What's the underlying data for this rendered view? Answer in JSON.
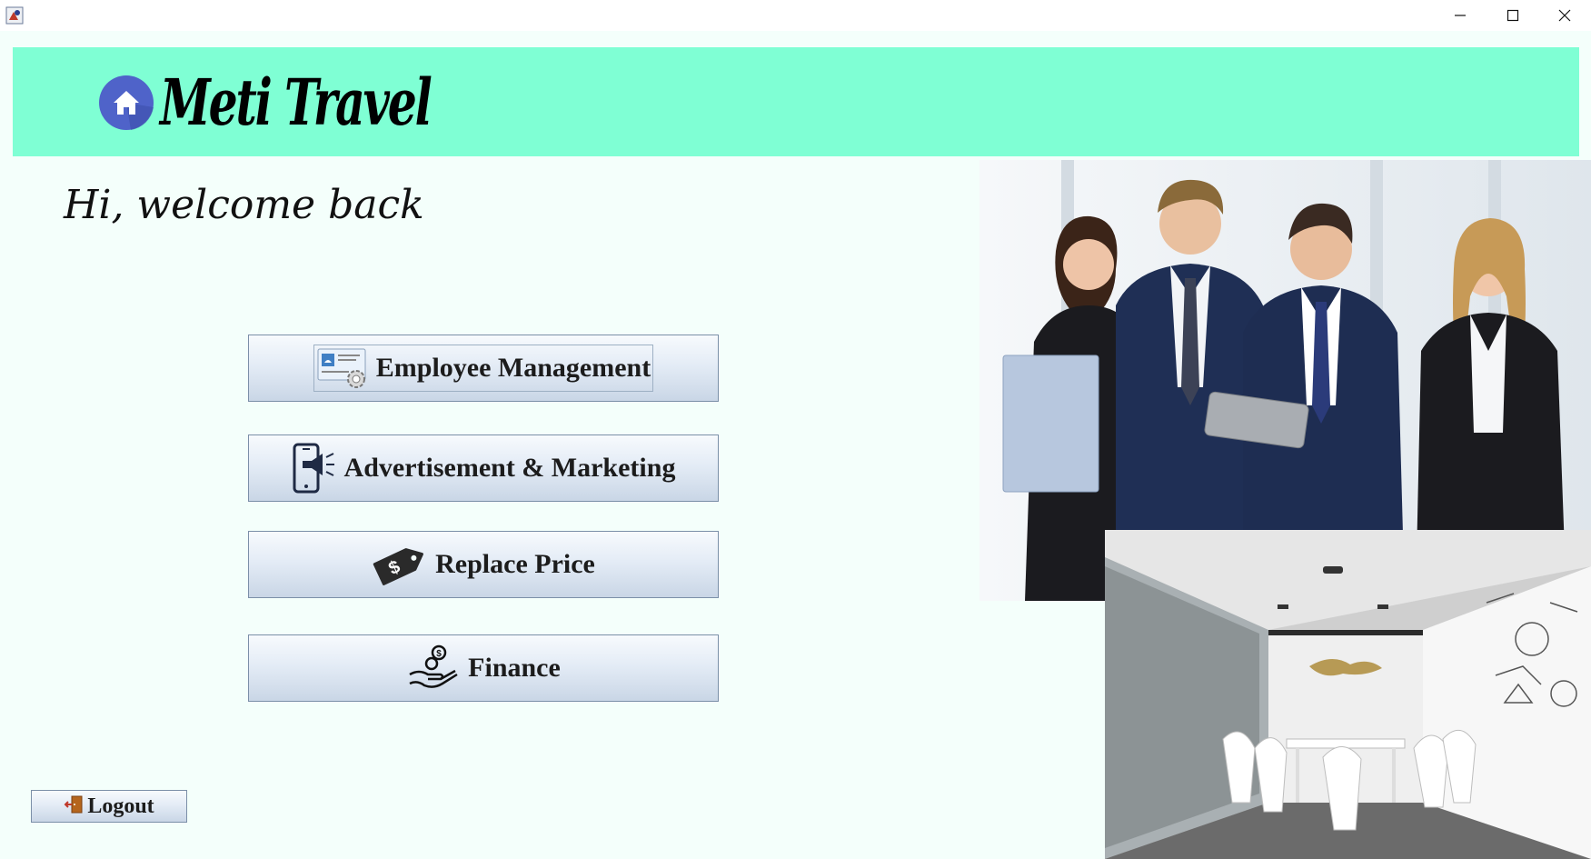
{
  "window": {
    "minimize_icon": "minimize-icon",
    "maximize_icon": "maximize-icon",
    "close_icon": "close-icon"
  },
  "header": {
    "brand": "Meti Travel",
    "icon": "home-icon",
    "background": "#7fffd4"
  },
  "welcome": "Hi, welcome back",
  "menu": {
    "employee": {
      "label": "Employee Management",
      "icon": "id-card-gear-icon"
    },
    "advertisement": {
      "label": "Advertisement & Marketing",
      "icon": "phone-megaphone-icon"
    },
    "price": {
      "label": "Replace Price",
      "icon": "price-tag-icon"
    },
    "finance": {
      "label": "Finance",
      "icon": "hand-coin-icon"
    }
  },
  "logout": {
    "label": "Logout",
    "icon": "exit-door-icon"
  },
  "images": {
    "team": "business-team-photo",
    "room": "meeting-room-photo"
  }
}
